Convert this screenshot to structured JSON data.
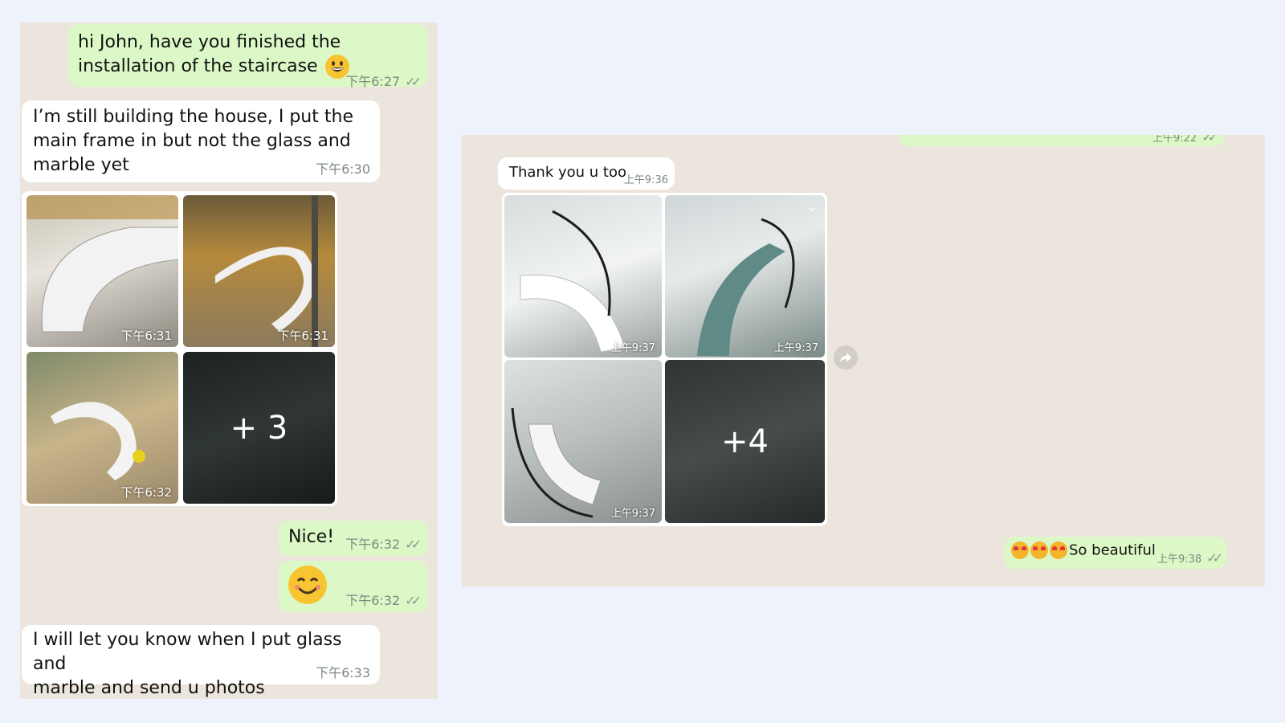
{
  "left_chat": {
    "msg1": {
      "text_line1": "hi John, have you finished the",
      "text_line2": "installation of the staircase",
      "time": "下午6:27"
    },
    "msg2": {
      "line1": "I’m still building the house, I put the",
      "line2": "main frame in but not the glass and",
      "line3": "marble yet",
      "time": "下午6:30"
    },
    "photos": [
      {
        "time": "下午6:31"
      },
      {
        "time": "下午6:31"
      },
      {
        "time": "下午6:32"
      },
      {
        "more": "+ 3"
      }
    ],
    "msg3": {
      "text": "Nice!",
      "time": "下午6:32"
    },
    "msg4": {
      "time": "下午6:32"
    },
    "msg5": {
      "line1": "I will let you know when I put glass and",
      "line2": "marble and send u photos",
      "time": "下午6:33"
    }
  },
  "right_chat": {
    "partial_time": "上午9:22",
    "msg1": {
      "text": "Thank you u too",
      "time": "上午9:36"
    },
    "photos": [
      {
        "time": "上午9:37"
      },
      {
        "time": "上午9:37"
      },
      {
        "time": "上午9:37"
      },
      {
        "more": "+4"
      }
    ],
    "msg2": {
      "text": "So beautiful",
      "time": "上午9:38"
    }
  },
  "colors": {
    "outgoing": "#dcf8c6",
    "incoming": "#ffffff",
    "chat_bg": "#ece5dd",
    "page_bg": "#eef2fa"
  },
  "icons": [
    "double-check-icon",
    "grinning-emoji-icon",
    "smiling-emoji-icon",
    "heart-eyes-emoji-icon",
    "forward-icon",
    "chevron-down-icon"
  ]
}
